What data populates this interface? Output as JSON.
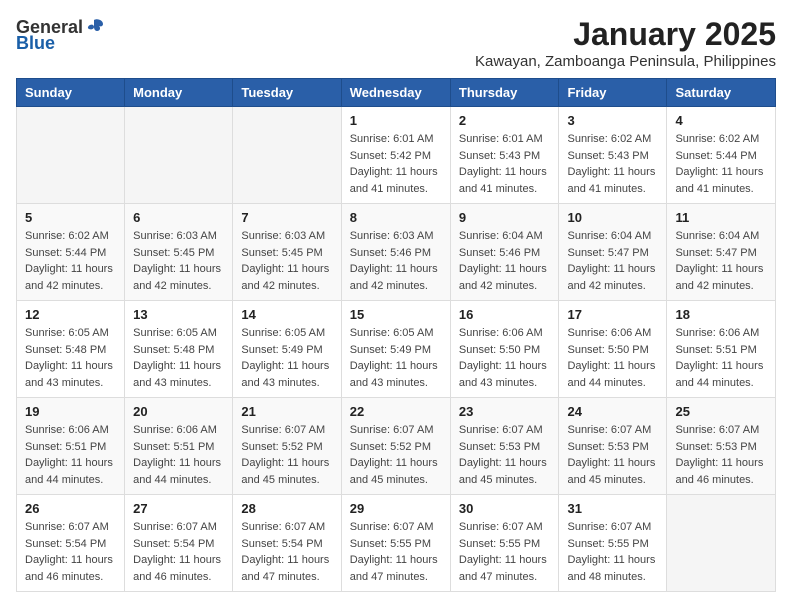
{
  "logo": {
    "text_general": "General",
    "text_blue": "Blue"
  },
  "title": "January 2025",
  "subtitle": "Kawayan, Zamboanga Peninsula, Philippines",
  "days_of_week": [
    "Sunday",
    "Monday",
    "Tuesday",
    "Wednesday",
    "Thursday",
    "Friday",
    "Saturday"
  ],
  "weeks": [
    [
      {
        "day": "",
        "info": ""
      },
      {
        "day": "",
        "info": ""
      },
      {
        "day": "",
        "info": ""
      },
      {
        "day": "1",
        "info": "Sunrise: 6:01 AM\nSunset: 5:42 PM\nDaylight: 11 hours and 41 minutes."
      },
      {
        "day": "2",
        "info": "Sunrise: 6:01 AM\nSunset: 5:43 PM\nDaylight: 11 hours and 41 minutes."
      },
      {
        "day": "3",
        "info": "Sunrise: 6:02 AM\nSunset: 5:43 PM\nDaylight: 11 hours and 41 minutes."
      },
      {
        "day": "4",
        "info": "Sunrise: 6:02 AM\nSunset: 5:44 PM\nDaylight: 11 hours and 41 minutes."
      }
    ],
    [
      {
        "day": "5",
        "info": "Sunrise: 6:02 AM\nSunset: 5:44 PM\nDaylight: 11 hours and 42 minutes."
      },
      {
        "day": "6",
        "info": "Sunrise: 6:03 AM\nSunset: 5:45 PM\nDaylight: 11 hours and 42 minutes."
      },
      {
        "day": "7",
        "info": "Sunrise: 6:03 AM\nSunset: 5:45 PM\nDaylight: 11 hours and 42 minutes."
      },
      {
        "day": "8",
        "info": "Sunrise: 6:03 AM\nSunset: 5:46 PM\nDaylight: 11 hours and 42 minutes."
      },
      {
        "day": "9",
        "info": "Sunrise: 6:04 AM\nSunset: 5:46 PM\nDaylight: 11 hours and 42 minutes."
      },
      {
        "day": "10",
        "info": "Sunrise: 6:04 AM\nSunset: 5:47 PM\nDaylight: 11 hours and 42 minutes."
      },
      {
        "day": "11",
        "info": "Sunrise: 6:04 AM\nSunset: 5:47 PM\nDaylight: 11 hours and 42 minutes."
      }
    ],
    [
      {
        "day": "12",
        "info": "Sunrise: 6:05 AM\nSunset: 5:48 PM\nDaylight: 11 hours and 43 minutes."
      },
      {
        "day": "13",
        "info": "Sunrise: 6:05 AM\nSunset: 5:48 PM\nDaylight: 11 hours and 43 minutes."
      },
      {
        "day": "14",
        "info": "Sunrise: 6:05 AM\nSunset: 5:49 PM\nDaylight: 11 hours and 43 minutes."
      },
      {
        "day": "15",
        "info": "Sunrise: 6:05 AM\nSunset: 5:49 PM\nDaylight: 11 hours and 43 minutes."
      },
      {
        "day": "16",
        "info": "Sunrise: 6:06 AM\nSunset: 5:50 PM\nDaylight: 11 hours and 43 minutes."
      },
      {
        "day": "17",
        "info": "Sunrise: 6:06 AM\nSunset: 5:50 PM\nDaylight: 11 hours and 44 minutes."
      },
      {
        "day": "18",
        "info": "Sunrise: 6:06 AM\nSunset: 5:51 PM\nDaylight: 11 hours and 44 minutes."
      }
    ],
    [
      {
        "day": "19",
        "info": "Sunrise: 6:06 AM\nSunset: 5:51 PM\nDaylight: 11 hours and 44 minutes."
      },
      {
        "day": "20",
        "info": "Sunrise: 6:06 AM\nSunset: 5:51 PM\nDaylight: 11 hours and 44 minutes."
      },
      {
        "day": "21",
        "info": "Sunrise: 6:07 AM\nSunset: 5:52 PM\nDaylight: 11 hours and 45 minutes."
      },
      {
        "day": "22",
        "info": "Sunrise: 6:07 AM\nSunset: 5:52 PM\nDaylight: 11 hours and 45 minutes."
      },
      {
        "day": "23",
        "info": "Sunrise: 6:07 AM\nSunset: 5:53 PM\nDaylight: 11 hours and 45 minutes."
      },
      {
        "day": "24",
        "info": "Sunrise: 6:07 AM\nSunset: 5:53 PM\nDaylight: 11 hours and 45 minutes."
      },
      {
        "day": "25",
        "info": "Sunrise: 6:07 AM\nSunset: 5:53 PM\nDaylight: 11 hours and 46 minutes."
      }
    ],
    [
      {
        "day": "26",
        "info": "Sunrise: 6:07 AM\nSunset: 5:54 PM\nDaylight: 11 hours and 46 minutes."
      },
      {
        "day": "27",
        "info": "Sunrise: 6:07 AM\nSunset: 5:54 PM\nDaylight: 11 hours and 46 minutes."
      },
      {
        "day": "28",
        "info": "Sunrise: 6:07 AM\nSunset: 5:54 PM\nDaylight: 11 hours and 47 minutes."
      },
      {
        "day": "29",
        "info": "Sunrise: 6:07 AM\nSunset: 5:55 PM\nDaylight: 11 hours and 47 minutes."
      },
      {
        "day": "30",
        "info": "Sunrise: 6:07 AM\nSunset: 5:55 PM\nDaylight: 11 hours and 47 minutes."
      },
      {
        "day": "31",
        "info": "Sunrise: 6:07 AM\nSunset: 5:55 PM\nDaylight: 11 hours and 48 minutes."
      },
      {
        "day": "",
        "info": ""
      }
    ]
  ]
}
